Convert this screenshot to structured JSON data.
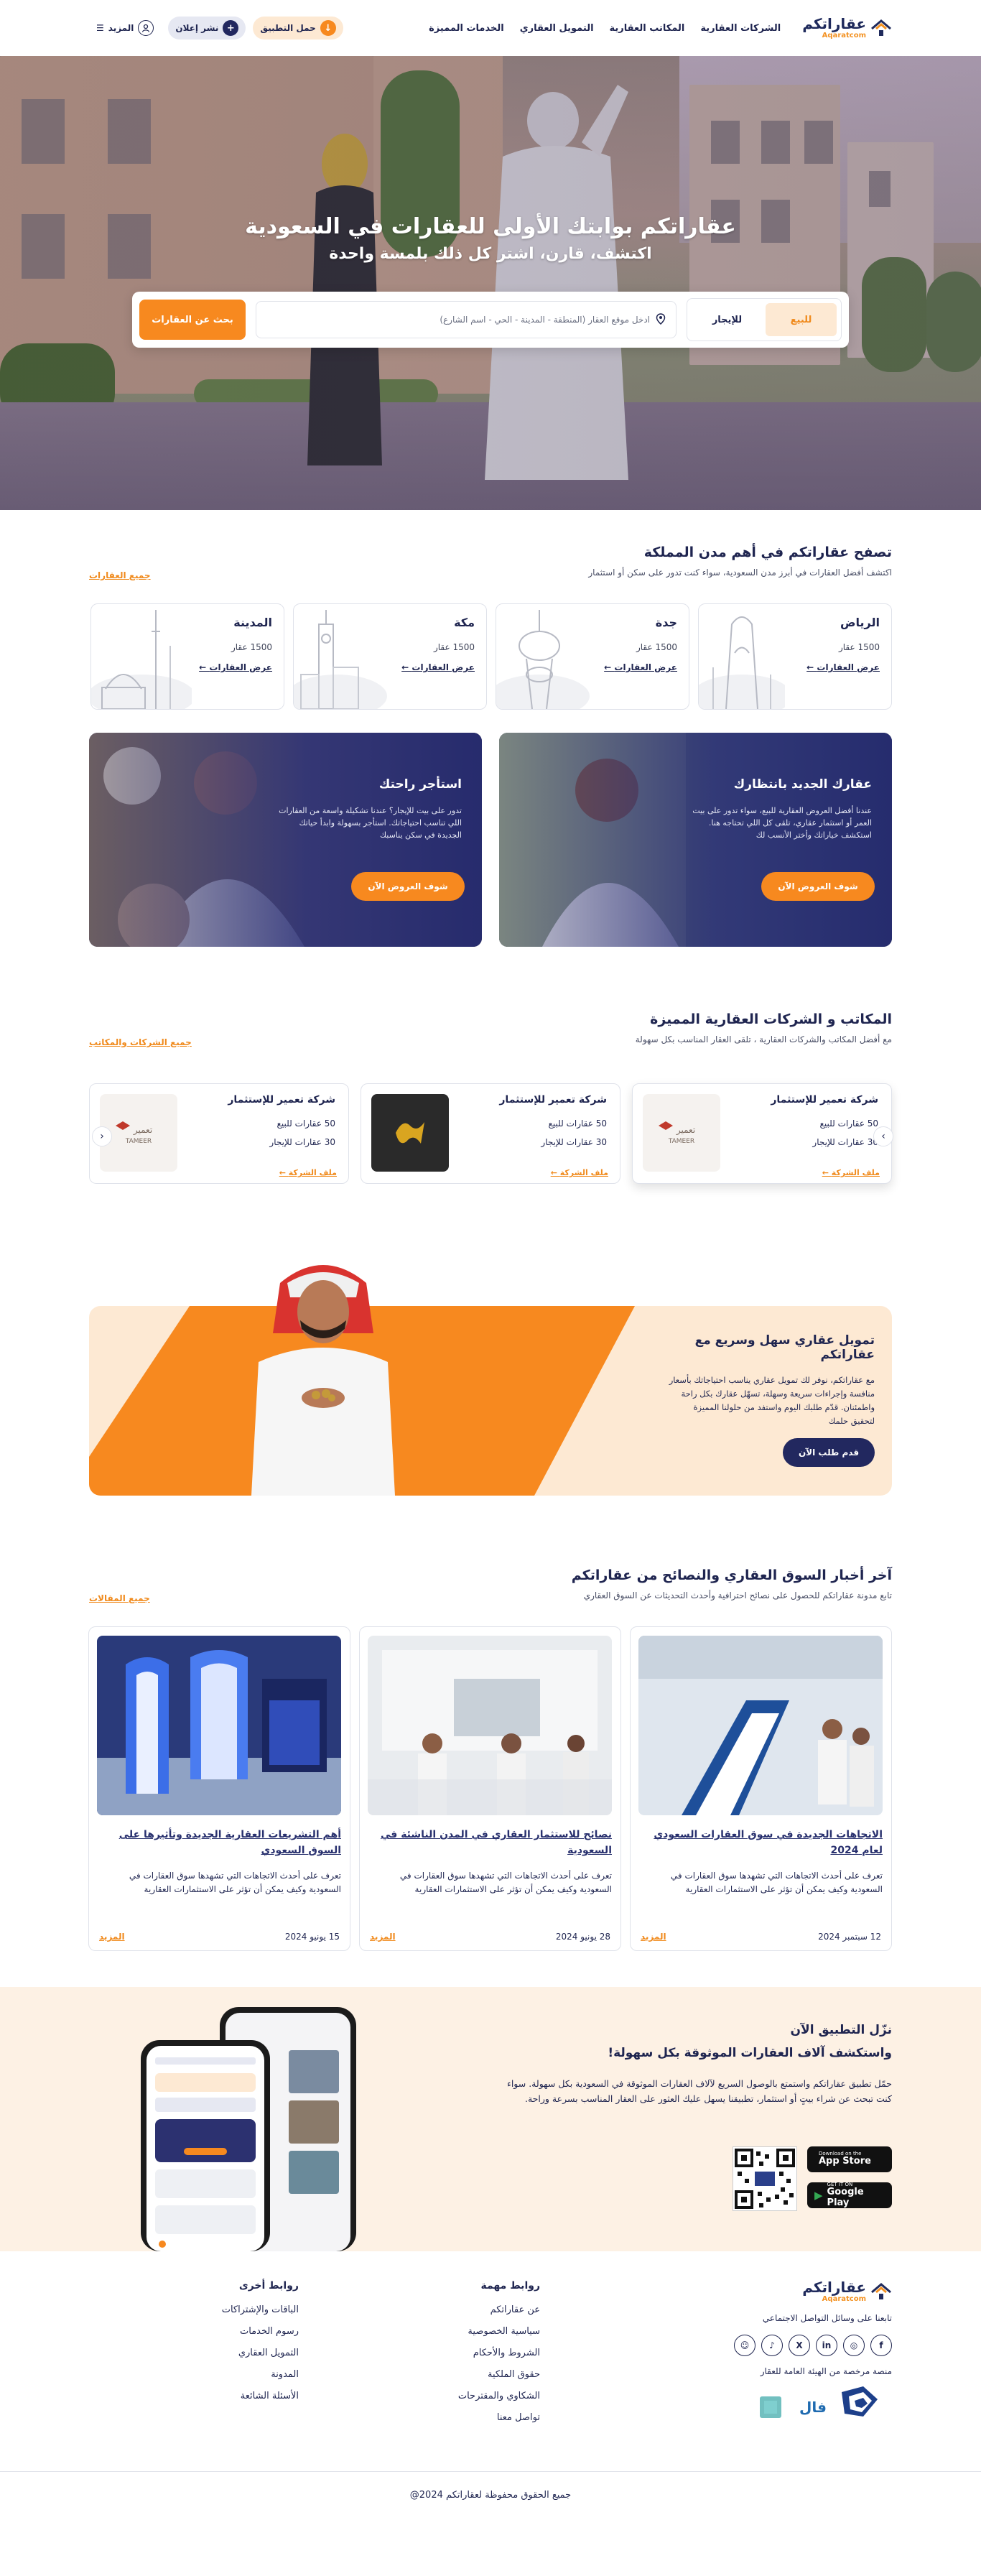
{
  "header": {
    "logo_ar": "عقاراتكم",
    "logo_en": "Aqaratcom",
    "nav": [
      "الشركات العقارية",
      "المكاتب العقارية",
      "التمويل العقاري",
      "الخدمات المميزة"
    ],
    "app_button": "حمل التطبيق",
    "post_button": "نشر إعلان",
    "more_button": "المزيد"
  },
  "hero": {
    "title": "عقاراتكم بوابتك الأولى للعقارات في السعودية",
    "subtitle": "اكتشف، قارن، اشتر كل ذلك بلمسة واحدة",
    "tab_sale": "للبيع",
    "tab_rent": "للإيجار",
    "location_placeholder": "ادخل موقع العقار (المنطقة - المدينة - الحي - اسم الشارع)",
    "search_button": "بحث عن العقارات"
  },
  "cities": {
    "title": "تصفح عقاراتكم في أهم مدن المملكة",
    "subtitle": "اكتشف أفضل العقارات في أبرز مدن السعودية، سواء كنت تدور على سكن أو استثمار",
    "all_link": "جميع العقارات",
    "items": [
      {
        "name": "الرياض",
        "count": "1500 عقار",
        "link": "عرض العقارات"
      },
      {
        "name": "جدة",
        "count": "1500 عقار",
        "link": "عرض العقارات"
      },
      {
        "name": "مكة",
        "count": "1500 عقار",
        "link": "عرض العقارات"
      },
      {
        "name": "المدينة",
        "count": "1500 عقار",
        "link": "عرض العقارات"
      }
    ]
  },
  "promos": [
    {
      "title": "عقارك الجديد بانتظارك",
      "desc": "عندنا أفضل العروض العقارية للبيع، سواء تدور على بيت العمر أو استثمار عقاري، تلقى كل اللي تحتاجه هنا. استكشف خياراتك وأختر الأنسب لك",
      "button": "شوف العروض الآن"
    },
    {
      "title": "استأجر راحتك",
      "desc": "تدور على بيت للإيجار؟ عندنا تشكيلة واسعة من العقارات اللي تناسب احتياجاتك. استأجر بسهولة وابدأ حياتك الجديدة في سكن يناسبك",
      "button": "شوف العروض الآن"
    }
  ],
  "offices": {
    "title": "المكاتب و الشركات العقارية المميزة",
    "subtitle": "مع أفضل المكاتب والشركات العقارية ، تلقى العقار المناسب بكل سهولة",
    "all_link": "جميع الشركات والمكاتب",
    "items": [
      {
        "name": "شركة تعمير للإستثمار",
        "sale": "50 عقارات للبيع",
        "rent": "30 عقارات للإيجار",
        "link": "ملف الشركة",
        "logo": "TAMEER"
      },
      {
        "name": "شركة تعمير للإستثمار",
        "sale": "50 عقارات للبيع",
        "rent": "30 عقارات للإيجار",
        "link": "ملف الشركة",
        "logo": "gold"
      },
      {
        "name": "شركة تعمير للإستثمار",
        "sale": "50 عقارات للبيع",
        "rent": "30 عقارات للإيجار",
        "link": "ملف الشركة",
        "logo": "TAMEER"
      }
    ]
  },
  "finance": {
    "title": "تمويل عقاري سهل وسريع مع عقاراتكم",
    "desc": "مع عقاراتكم، نوفر لك تمويل عقاري يناسب احتياجاتك بأسعار منافسة وإجراءات سريعة وسهلة، تسهّل عقارك بكل راحة واطمئنان. قدّم طلبك اليوم واستفد من حلولنا المميزة لتحقيق حلمك",
    "button": "قدم طلب الآن"
  },
  "news": {
    "title": "آخر أخبار السوق العقاري والنصائح من عقاراتكم",
    "subtitle": "تابع مدونة عقاراتكم للحصول على نصائح احترافية وأحدث التحديثات عن السوق العقاري",
    "all_link": "جميع المقالات",
    "items": [
      {
        "title": "الاتجاهات الجديدة في سوق العقارات السعودي لعام 2024",
        "desc": "تعرف على أحدث الاتجاهات التي تشهدها سوق العقارات في السعودية وكيف يمكن أن تؤثر على الاستثمارات العقارية",
        "date": "12 سبتمبر 2024",
        "more": "المزيد"
      },
      {
        "title": "نصائح للاستثمار العقاري في المدن الناشئة في السعودية",
        "desc": "تعرف على أحدث الاتجاهات التي تشهدها سوق العقارات في السعودية وكيف يمكن أن تؤثر على الاستثمارات العقارية",
        "date": "28 يونيو 2024",
        "more": "المزيد"
      },
      {
        "title": "أهم التشريعات العقارية الجديدة وتأثيرها على السوق السعودي",
        "desc": "تعرف على أحدث الاتجاهات التي تشهدها سوق العقارات في السعودية وكيف يمكن أن تؤثر على الاستثمارات العقارية",
        "date": "15 يونيو 2024",
        "more": "المزيد"
      }
    ]
  },
  "app": {
    "title1": "نزّل التطبيق الآن",
    "title2": "واستكشف آلاف العقارات الموثوقة بكل سهولة!",
    "desc": "حمّل تطبيق عقاراتكم واستمتع بالوصول السريع لآلاف العقارات الموثوقة في السعودية بكل سهولة. سواء كنت تبحث عن شراء بيتٍ أو استثمار، تطبيقنا يسهل عليك العثور على العقار المناسب بسرعة وراحة.",
    "appstore_small": "Download on the",
    "appstore_big": "App Store",
    "gplay_small": "GET IT ON",
    "gplay_big": "Google Play"
  },
  "footer": {
    "follow": "تابعنا على وسائل التواصل الاجتماعي",
    "licensed": "منصة مرخصة من الهيئة العامة للعقار",
    "important_head": "روابط مهمة",
    "important": [
      "عن عقاراتكم",
      "سياسية الخصوصية",
      "الشروط والأحكام",
      "حقوق الملكية",
      "الشكاوي والمقترحات",
      "تواصل معنا"
    ],
    "other_head": "روابط أخرى",
    "other": [
      "الباقات والإشتراكات",
      "رسوم الخدمات",
      "التمويل العقاري",
      "المدونة",
      "الأسئلة الشائعة"
    ],
    "copyright": "جميع الحقوق محفوظة لعقاراتكم 2024@"
  },
  "colors": {
    "primary": "#1f2550",
    "accent": "#f7891f",
    "cream": "#fde9d3"
  }
}
